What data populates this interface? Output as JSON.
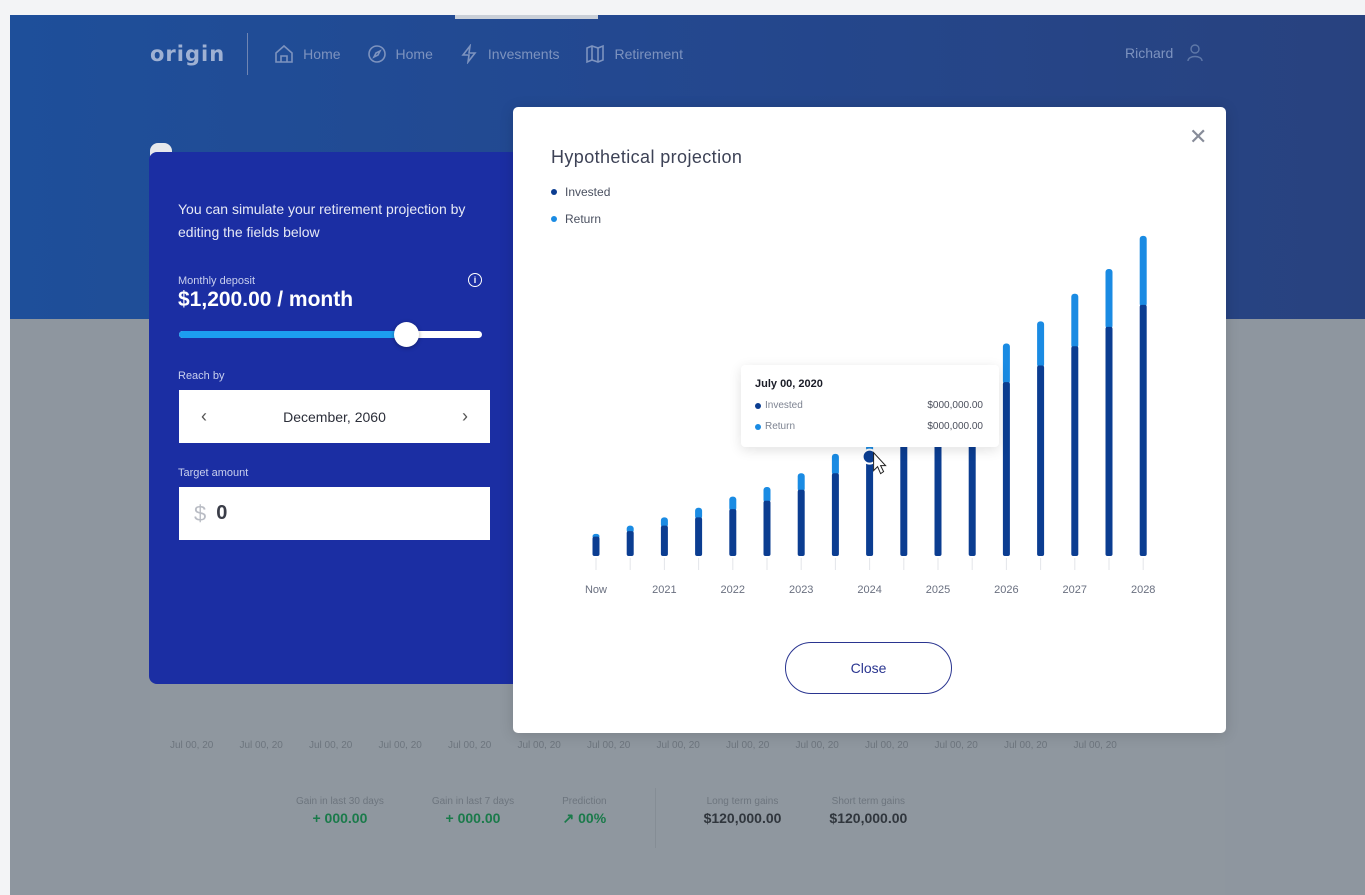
{
  "nav": {
    "logo": "origin",
    "items": [
      {
        "label": "Home",
        "icon": "home-icon"
      },
      {
        "label": "Home",
        "icon": "compass-icon"
      },
      {
        "label": "Invesments",
        "icon": "lightning-icon"
      },
      {
        "label": "Retirement",
        "icon": "map-icon"
      }
    ],
    "user": "Richard"
  },
  "simulator": {
    "intro": "You can simulate your retirement projection by editing the fields below",
    "deposit_label": "Monthly deposit",
    "deposit_value": "$1,200.00 / month",
    "slider_fraction": 0.75,
    "reach_label": "Reach by",
    "reach_value": "December, 2060",
    "target_label": "Target amount",
    "target_currency": "$",
    "target_value": "0"
  },
  "modal": {
    "title": "Hypothetical projection",
    "close_label": "Close",
    "legend": [
      {
        "label": "Invested",
        "color": "#0b3d91"
      },
      {
        "label": "Return",
        "color": "#1a8be3"
      }
    ],
    "tooltip": {
      "title": "July 00, 2020",
      "rows": [
        {
          "label": "Invested",
          "value": "$000,000.00",
          "color": "#0b3d91"
        },
        {
          "label": "Return",
          "value": "$000,000.00",
          "color": "#1a8be3"
        }
      ]
    }
  },
  "chart_data": {
    "type": "bar",
    "stacked": true,
    "x_labels": [
      "Now",
      "2021",
      "2022",
      "2023",
      "2024",
      "2025",
      "2026",
      "2027",
      "2028"
    ],
    "series": [
      {
        "name": "Invested",
        "color": "#0b3d91",
        "values": [
          14,
          18,
          22,
          28,
          34,
          40,
          48,
          60,
          72,
          82,
          90,
          98,
          126,
          138,
          152,
          166,
          182
        ]
      },
      {
        "name": "Return",
        "color": "#1a8be3",
        "values": [
          2,
          4,
          6,
          7,
          9,
          10,
          12,
          14,
          16,
          18,
          21,
          24,
          28,
          32,
          38,
          42,
          50
        ]
      }
    ],
    "highlighted_index": 8
  },
  "background": {
    "dates": [
      "Jul 00, 20",
      "Jul 00, 20",
      "Jul 00, 20",
      "Jul 00, 20",
      "Jul 00, 20",
      "Jul 00, 20",
      "Jul 00, 20",
      "Jul 00, 20",
      "Jul 00, 20",
      "Jul 00, 20",
      "Jul 00, 20",
      "Jul 00, 20",
      "Jul 00, 20",
      "Jul 00, 20"
    ],
    "stats": [
      {
        "label": "Gain in last 30 days",
        "value": "+ 000.00",
        "tone": "green"
      },
      {
        "label": "Gain in last 7 days",
        "value": "+ 000.00",
        "tone": "green"
      },
      {
        "label": "Prediction",
        "value": "↗ 00%",
        "tone": "green"
      },
      {
        "label": "Long term gains",
        "value": "$120,000.00",
        "tone": "dark"
      },
      {
        "label": "Short term gains",
        "value": "$120,000.00",
        "tone": "dark"
      }
    ]
  }
}
